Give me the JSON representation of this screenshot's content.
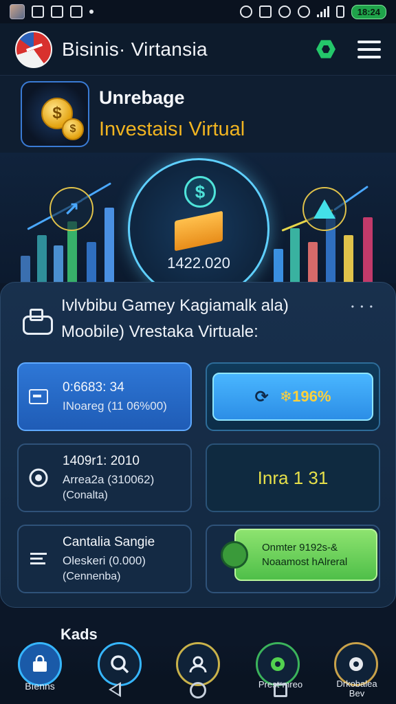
{
  "status_bar": {
    "battery_time": "18:24"
  },
  "header": {
    "app_title": "Bisinis· Virtansia"
  },
  "profile": {
    "name": "Unrebage",
    "subtitle": "Investaisı Virtual"
  },
  "hero": {
    "value": "1422.020"
  },
  "card": {
    "line1": "Ivlvbibu Gamey Kagiamalk ala)",
    "line2": "Moobile) Vrestaka Virtuale:",
    "tiles": [
      {
        "t1": "0:6683: 34",
        "t2": "INoareg (11 06%00)"
      },
      {
        "label": "❄196%"
      },
      {
        "t1": "1409r1: 2010",
        "t2": "Arrea2a (310062)",
        "t3": "(Conalta)"
      },
      {
        "label": "Inra 1 31"
      },
      {
        "t1": "Cantalia Sangie",
        "t2": "Oleskeri (0.000)",
        "t3": "(Cennenba)"
      },
      {
        "g1": "Onmter 9192s-&",
        "g2": "Noaamost hAlreral"
      }
    ]
  },
  "partial_label": "Kads",
  "bottom_nav": {
    "items": [
      {
        "label": "Bıenns"
      },
      {
        "label": ""
      },
      {
        "label": ""
      },
      {
        "label": "Prestˣmreo"
      },
      {
        "label": "Drkobalea Bev"
      }
    ]
  },
  "colors": {
    "accent_gold": "#f2b521",
    "accent_green": "#24c76a",
    "accent_blue": "#2e77d6",
    "background": "#0c1728"
  }
}
